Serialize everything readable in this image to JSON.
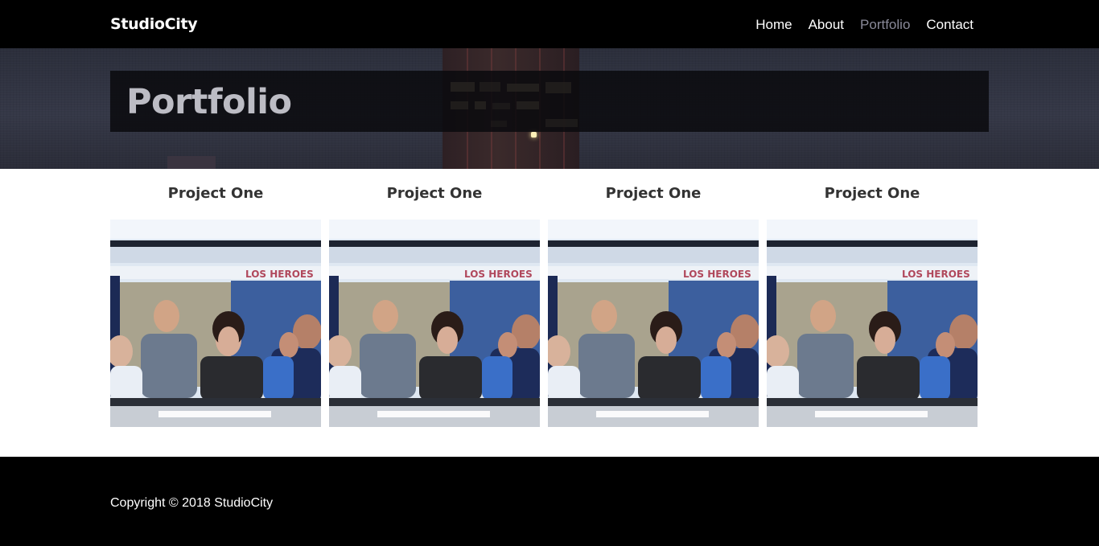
{
  "nav": {
    "brand": "StudioCity",
    "links": [
      {
        "label": "Home",
        "active": false
      },
      {
        "label": "About",
        "active": false
      },
      {
        "label": "Portfolio",
        "active": true
      },
      {
        "label": "Contact",
        "active": false
      }
    ]
  },
  "hero": {
    "title": "Portfolio"
  },
  "portfolio": {
    "items": [
      {
        "title": "Project One",
        "sign_text": "LOS HEROES"
      },
      {
        "title": "Project One",
        "sign_text": "LOS HEROES"
      },
      {
        "title": "Project One",
        "sign_text": "LOS HEROES"
      },
      {
        "title": "Project One",
        "sign_text": "LOS HEROES"
      }
    ]
  },
  "footer": {
    "copyright": "Copyright © 2018 StudioCity"
  },
  "colors": {
    "navbar_bg": "#000000",
    "nav_active": "#8a8a99",
    "footer_bg": "#000000",
    "title_box_bg": "#0a0a0e"
  }
}
